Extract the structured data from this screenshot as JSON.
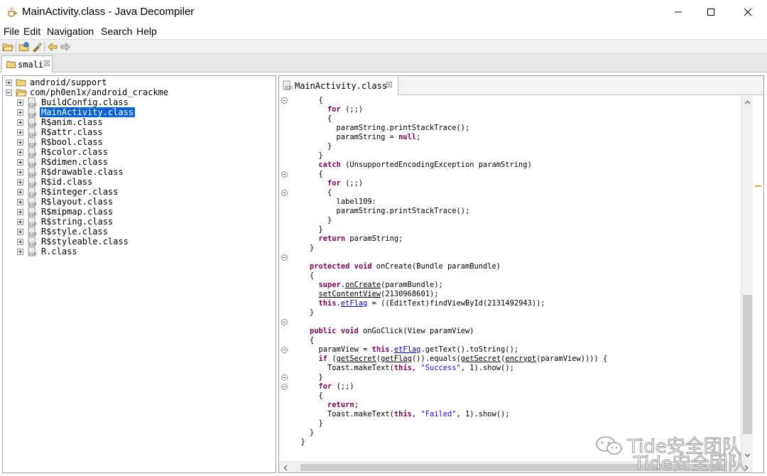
{
  "window": {
    "title": "MainActivity.class - Java Decompiler",
    "app_icon": "coffee-cup-icon"
  },
  "menu": [
    "File",
    "Edit",
    "Navigation",
    "Search",
    "Help"
  ],
  "toolbar": {
    "icons": [
      "open-folder-icon",
      "open-type-icon",
      "search-flashlight-icon",
      "back-arrow-icon",
      "forward-arrow-icon"
    ]
  },
  "outer_tab": {
    "label": "smali",
    "close": "☒"
  },
  "tree": {
    "nodes": [
      {
        "label": "android/support",
        "kind": "package",
        "expander": "plus"
      },
      {
        "label": "com/ph0en1x/android_crackme",
        "kind": "package-open",
        "expander": "minus"
      },
      {
        "label": "BuildConfig.class",
        "kind": "class",
        "expander": "plus"
      },
      {
        "label": "MainActivity.class",
        "kind": "class",
        "expander": "plus",
        "selected": true
      },
      {
        "label": "R$anim.class",
        "kind": "class",
        "expander": "plus"
      },
      {
        "label": "R$attr.class",
        "kind": "class",
        "expander": "plus"
      },
      {
        "label": "R$bool.class",
        "kind": "class",
        "expander": "plus"
      },
      {
        "label": "R$color.class",
        "kind": "class",
        "expander": "plus"
      },
      {
        "label": "R$dimen.class",
        "kind": "class",
        "expander": "plus"
      },
      {
        "label": "R$drawable.class",
        "kind": "class",
        "expander": "plus"
      },
      {
        "label": "R$id.class",
        "kind": "class",
        "expander": "plus"
      },
      {
        "label": "R$integer.class",
        "kind": "class",
        "expander": "plus"
      },
      {
        "label": "R$layout.class",
        "kind": "class",
        "expander": "plus"
      },
      {
        "label": "R$mipmap.class",
        "kind": "class",
        "expander": "plus"
      },
      {
        "label": "R$string.class",
        "kind": "class",
        "expander": "plus"
      },
      {
        "label": "R$style.class",
        "kind": "class",
        "expander": "plus"
      },
      {
        "label": "R$styleable.class",
        "kind": "class",
        "expander": "plus"
      },
      {
        "label": "R.class",
        "kind": "class",
        "expander": "plus"
      }
    ]
  },
  "editor": {
    "tab_label": "MainActivity.class",
    "tab_close": "☒",
    "code_lines": [
      [
        [
          "      {",
          ""
        ]
      ],
      [
        [
          "        ",
          ""
        ],
        [
          "for",
          "kw"
        ],
        [
          " (;;)",
          ""
        ]
      ],
      [
        [
          "        {",
          ""
        ]
      ],
      [
        [
          "          paramString.printStackTrace();",
          ""
        ]
      ],
      [
        [
          "          paramString = ",
          ""
        ],
        [
          "null",
          "kw"
        ],
        [
          ";",
          ""
        ]
      ],
      [
        [
          "        }",
          ""
        ]
      ],
      [
        [
          "      }",
          ""
        ]
      ],
      [
        [
          "      ",
          ""
        ],
        [
          "catch",
          "kw"
        ],
        [
          " (UnsupportedEncodingException paramString)",
          ""
        ]
      ],
      [
        [
          "      {",
          ""
        ]
      ],
      [
        [
          "        ",
          ""
        ],
        [
          "for",
          "kw"
        ],
        [
          " (;;)",
          ""
        ]
      ],
      [
        [
          "        {",
          ""
        ]
      ],
      [
        [
          "          label109:",
          ""
        ]
      ],
      [
        [
          "          paramString.printStackTrace();",
          ""
        ]
      ],
      [
        [
          "        }",
          ""
        ]
      ],
      [
        [
          "      }",
          ""
        ]
      ],
      [
        [
          "      ",
          ""
        ],
        [
          "return",
          "kw"
        ],
        [
          " paramString;",
          ""
        ]
      ],
      [
        [
          "    }",
          ""
        ]
      ],
      [
        [
          "",
          ""
        ]
      ],
      [
        [
          "    ",
          ""
        ],
        [
          "protected",
          "kw"
        ],
        [
          " ",
          ""
        ],
        [
          "void",
          "kw"
        ],
        [
          " onCreate(Bundle paramBundle)",
          ""
        ]
      ],
      [
        [
          "    {",
          ""
        ]
      ],
      [
        [
          "      ",
          ""
        ],
        [
          "super",
          "kw"
        ],
        [
          ".",
          ""
        ],
        [
          "onCreate",
          "und"
        ],
        [
          "(paramBundle);",
          ""
        ]
      ],
      [
        [
          "      ",
          ""
        ],
        [
          "setContentView",
          "und"
        ],
        [
          "(2130968601);",
          ""
        ]
      ],
      [
        [
          "      ",
          ""
        ],
        [
          "this",
          "kw"
        ],
        [
          ".",
          ""
        ],
        [
          "etFlag",
          "fld und"
        ],
        [
          " = ((EditText)findViewById(2131492943));",
          ""
        ]
      ],
      [
        [
          "    }",
          ""
        ]
      ],
      [
        [
          "",
          ""
        ]
      ],
      [
        [
          "    ",
          ""
        ],
        [
          "public",
          "kw"
        ],
        [
          " ",
          ""
        ],
        [
          "void",
          "kw"
        ],
        [
          " onGoClick(View paramView)",
          ""
        ]
      ],
      [
        [
          "    {",
          ""
        ]
      ],
      [
        [
          "      paramView = ",
          ""
        ],
        [
          "this",
          "kw"
        ],
        [
          ".",
          ""
        ],
        [
          "etFlag",
          "fld und"
        ],
        [
          ".getText().toString();",
          ""
        ]
      ],
      [
        [
          "      ",
          ""
        ],
        [
          "if",
          "kw"
        ],
        [
          " (",
          ""
        ],
        [
          "getSecret",
          "und"
        ],
        [
          "(",
          ""
        ],
        [
          "getFlag",
          "und"
        ],
        [
          "()).equals(",
          ""
        ],
        [
          "getSecret",
          "und"
        ],
        [
          "(",
          ""
        ],
        [
          "encrypt",
          "und"
        ],
        [
          "(paramView)))) {",
          ""
        ]
      ],
      [
        [
          "        Toast.makeText(",
          ""
        ],
        [
          "this",
          "kw"
        ],
        [
          ", ",
          ""
        ],
        [
          "\"Success\"",
          "str"
        ],
        [
          ", 1).show();",
          ""
        ]
      ],
      [
        [
          "      }",
          ""
        ]
      ],
      [
        [
          "      ",
          ""
        ],
        [
          "for",
          "kw"
        ],
        [
          " (;;)",
          ""
        ]
      ],
      [
        [
          "      {",
          ""
        ]
      ],
      [
        [
          "        ",
          ""
        ],
        [
          "return",
          "kw"
        ],
        [
          ";",
          ""
        ]
      ],
      [
        [
          "        Toast.makeText(",
          ""
        ],
        [
          "this",
          "kw"
        ],
        [
          ", ",
          ""
        ],
        [
          "\"Failed\"",
          "str"
        ],
        [
          ", 1).show();",
          ""
        ]
      ],
      [
        [
          "      }",
          ""
        ]
      ],
      [
        [
          "    }",
          ""
        ]
      ],
      [
        [
          "  }",
          ""
        ]
      ]
    ],
    "fold_markers": [
      0,
      8,
      10,
      17,
      24,
      27,
      30,
      31
    ]
  },
  "watermark": {
    "line1": "Tide安全团队",
    "line2": "Tide安全团队"
  }
}
